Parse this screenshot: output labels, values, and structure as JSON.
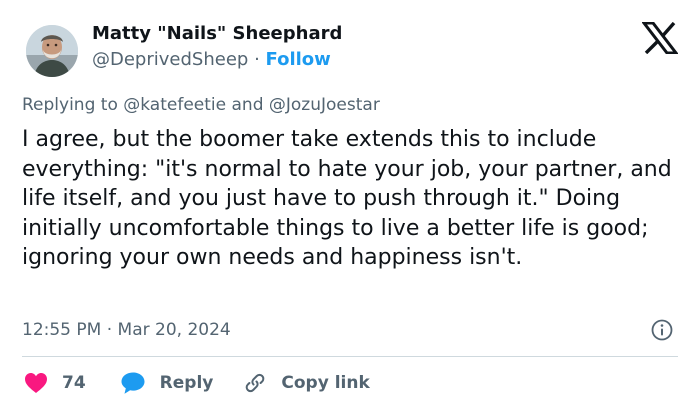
{
  "author": {
    "name": "Matty \"Nails\" Sheephard",
    "handle": "@DeprivedSheep",
    "separator": "·",
    "follow_label": "Follow"
  },
  "brand": {
    "logo_icon": "x-logo-icon"
  },
  "reply_context": {
    "prefix": "Replying to",
    "mention_1": "@katefeetie",
    "conjunction": "and",
    "mention_2": "@JozuJoestar"
  },
  "tweet": {
    "text": "I agree, but the boomer take extends this to include everything: \"it's normal to hate your job, your partner, and life itself, and you just have to push through it.\" Doing initially uncomfortable things to live a better life is good; ignoring your own needs and happiness isn't.",
    "timestamp": "12:55 PM · Mar 20, 2024"
  },
  "actions": {
    "like_count": "74",
    "reply_label": "Reply",
    "copy_link_label": "Copy link"
  },
  "colors": {
    "accent": "#1d9bf0",
    "like": "#f91880",
    "text": "#0f1419",
    "muted": "#536471",
    "divider": "#cfd9de"
  }
}
